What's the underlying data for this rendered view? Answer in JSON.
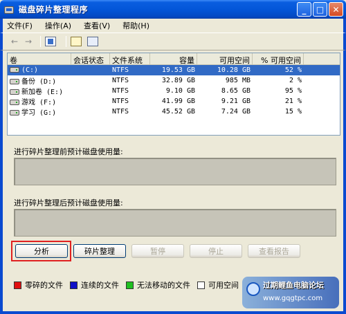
{
  "window": {
    "title": "磁盘碎片整理程序",
    "min": "_",
    "max": "□",
    "close": "✕"
  },
  "menu": [
    "文件(F)",
    "操作(A)",
    "查看(V)",
    "帮助(H)"
  ],
  "toolbar": {
    "back": "←",
    "forward": "→"
  },
  "columns": [
    "卷",
    "会话状态",
    "文件系统",
    "容量",
    "可用空间",
    "% 可用空间"
  ],
  "volumes": [
    {
      "name": "(C:)",
      "state": "",
      "fs": "NTFS",
      "capacity": "19.53 GB",
      "free": "10.28 GB",
      "pct": "52 %",
      "selected": true
    },
    {
      "name": "备份 (D:)",
      "state": "",
      "fs": "NTFS",
      "capacity": "32.89 GB",
      "free": "985 MB",
      "pct": "2 %",
      "selected": false
    },
    {
      "name": "新加卷 (E:)",
      "state": "",
      "fs": "NTFS",
      "capacity": "9.10 GB",
      "free": "8.65 GB",
      "pct": "95 %",
      "selected": false
    },
    {
      "name": "游戏 (F:)",
      "state": "",
      "fs": "NTFS",
      "capacity": "41.99 GB",
      "free": "9.21 GB",
      "pct": "21 %",
      "selected": false
    },
    {
      "name": "学习 (G:)",
      "state": "",
      "fs": "NTFS",
      "capacity": "45.52 GB",
      "free": "7.24 GB",
      "pct": "15 %",
      "selected": false
    }
  ],
  "before_label": "进行碎片整理前预计磁盘使用量:",
  "after_label": "进行碎片整理后预计磁盘使用量:",
  "buttons": {
    "analyze": "分析",
    "defrag": "碎片整理",
    "pause": "暂停",
    "stop": "停止",
    "report": "查看报告"
  },
  "legend": [
    {
      "label": "零碎的文件",
      "color": "#e01010"
    },
    {
      "label": "连续的文件",
      "color": "#1010c8"
    },
    {
      "label": "无法移动的文件",
      "color": "#20c020"
    },
    {
      "label": "可用空间",
      "color": "#ffffff"
    }
  ],
  "watermark": {
    "top": "过期鲤鱼电脑论坛",
    "bottom": "www.gqgtpc.com"
  }
}
